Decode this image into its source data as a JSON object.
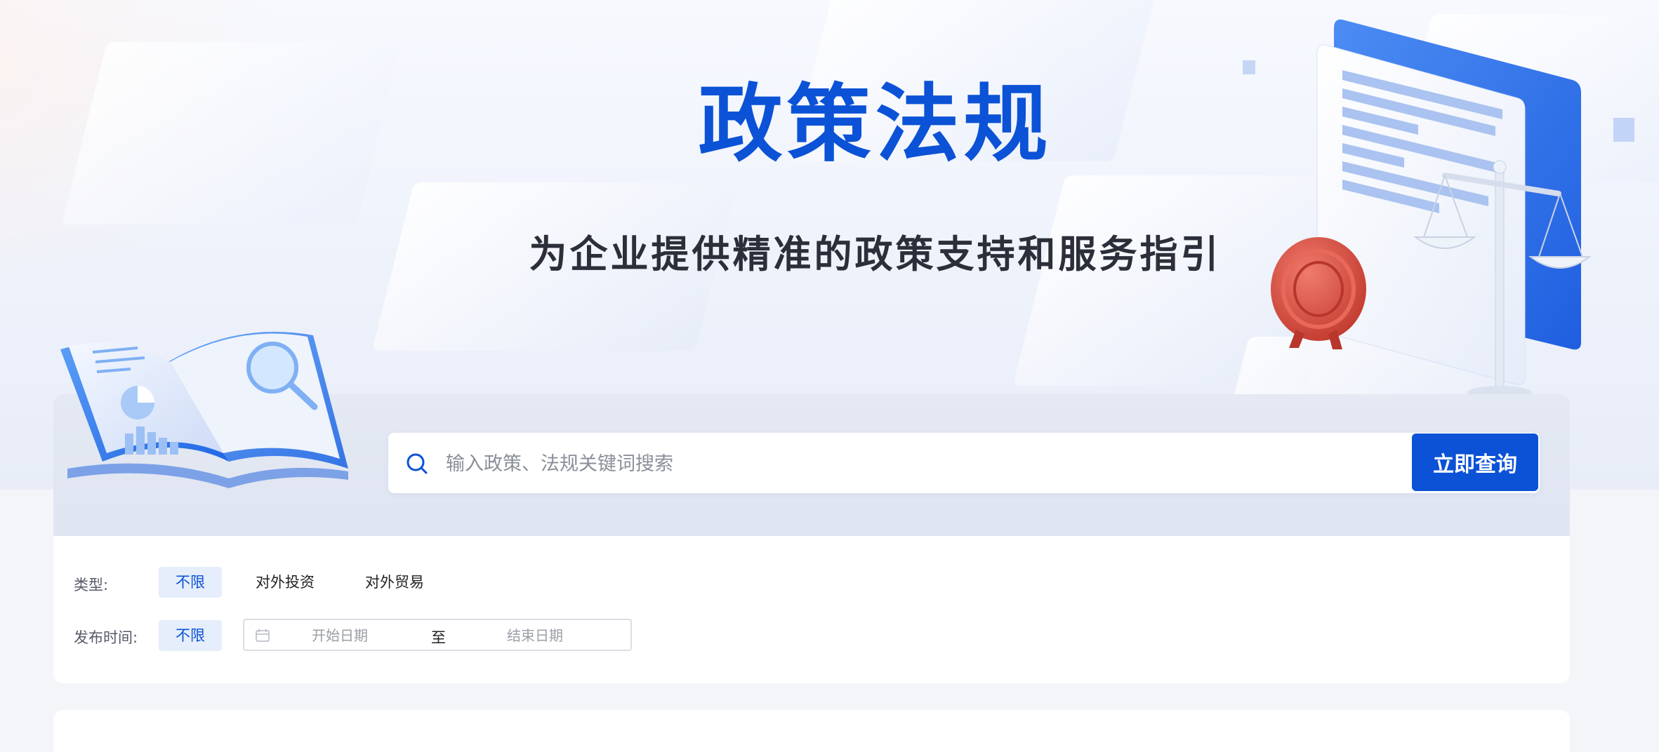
{
  "hero": {
    "title": "政策法规",
    "subtitle": "为企业提供精准的政策支持和服务指引"
  },
  "search": {
    "placeholder": "输入政策、法规关键词搜索",
    "button_label": "立即查询"
  },
  "filters": {
    "type": {
      "label": "类型:",
      "options": [
        "不限",
        "对外投资",
        "对外贸易"
      ],
      "selected": "不限"
    },
    "publish_time": {
      "label": "发布时间:",
      "options": [
        "不限"
      ],
      "selected": "不限",
      "start_placeholder": "开始日期",
      "separator": "至",
      "end_placeholder": "结束日期"
    }
  },
  "colors": {
    "brand": "#0b52d6",
    "chip_active_bg": "#e6eefc",
    "seal_red": "#d94a3d"
  },
  "icons": [
    "search-icon",
    "calendar-icon",
    "book-illustration",
    "document-illustration",
    "seal-illustration",
    "scales-illustration"
  ]
}
